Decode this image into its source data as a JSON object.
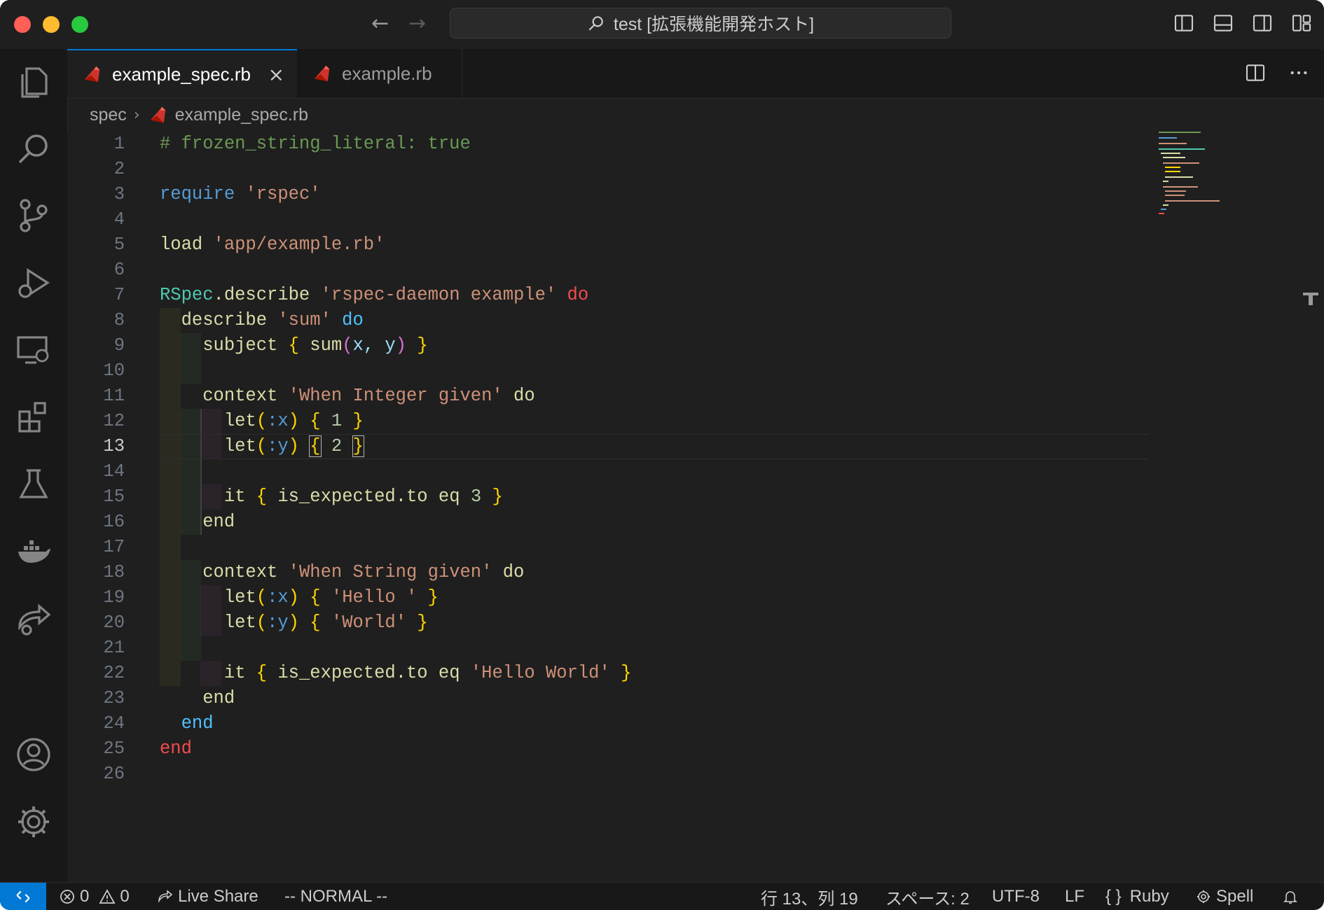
{
  "titlebar": {
    "search_text": "test [拡張機能開発ホスト]",
    "back_icon": "←",
    "forward_icon": "→"
  },
  "tabs": [
    {
      "label": "example_spec.rb",
      "active": true,
      "close": "×"
    },
    {
      "label": "example.rb",
      "active": false
    }
  ],
  "breadcrumb": {
    "folder": "spec",
    "sep": "›",
    "file": "example_spec.rb"
  },
  "editor": {
    "current_line": 13,
    "lines": [
      {
        "n": "1"
      },
      {
        "n": "2"
      },
      {
        "n": "3"
      },
      {
        "n": "4"
      },
      {
        "n": "5"
      },
      {
        "n": "6"
      },
      {
        "n": "7"
      },
      {
        "n": "8"
      },
      {
        "n": "9"
      },
      {
        "n": "10"
      },
      {
        "n": "11"
      },
      {
        "n": "12"
      },
      {
        "n": "13"
      },
      {
        "n": "14"
      },
      {
        "n": "15"
      },
      {
        "n": "16"
      },
      {
        "n": "17"
      },
      {
        "n": "18"
      },
      {
        "n": "19"
      },
      {
        "n": "20"
      },
      {
        "n": "21"
      },
      {
        "n": "22"
      },
      {
        "n": "23"
      },
      {
        "n": "24"
      },
      {
        "n": "25"
      },
      {
        "n": "26"
      }
    ],
    "code": {
      "l1": "# frozen_string_literal: true",
      "l3_kw": "require",
      "l3_str": "'rspec'",
      "l5_fn": "load",
      "l5_str": "'app/example.rb'",
      "l7_cls": "RSpec",
      "l7_fn": ".describe",
      "l7_str": "'rspec-daemon example'",
      "l7_do": "do",
      "l8_fn": "describe",
      "l8_str": "'sum'",
      "l8_do": "do",
      "l9_fn": "subject",
      "l9_ob": "{",
      "l9_call": "sum",
      "l9_op": "(",
      "l9_args": "x, y",
      "l9_cp": ")",
      "l9_cb": "}",
      "l11_fn": "context",
      "l11_str": "'When Integer given'",
      "l11_do": "do",
      "l12_fn": "let",
      "l12_op": "(",
      "l12_sym": ":x",
      "l12_cp": ")",
      "l12_ob": "{",
      "l12_val": "1",
      "l12_cb": "}",
      "l13_fn": "let",
      "l13_op": "(",
      "l13_sym": ":y",
      "l13_cp": ")",
      "l13_ob": "{",
      "l13_val": "2",
      "l13_cb": "}",
      "l15_fn": "it",
      "l15_ob": "{",
      "l15_body": "is_expected.to eq",
      "l15_val": "3",
      "l15_cb": "}",
      "l16_end": "end",
      "l18_fn": "context",
      "l18_str": "'When String given'",
      "l18_do": "do",
      "l19_fn": "let",
      "l19_op": "(",
      "l19_sym": ":x",
      "l19_cp": ")",
      "l19_ob": "{",
      "l19_str": "'Hello '",
      "l19_cb": "}",
      "l20_fn": "let",
      "l20_op": "(",
      "l20_sym": ":y",
      "l20_cp": ")",
      "l20_ob": "{",
      "l20_str": "'World'",
      "l20_cb": "}",
      "l22_fn": "it",
      "l22_ob": "{",
      "l22_body": "is_expected.to eq",
      "l22_str": "'Hello World'",
      "l22_cb": "}",
      "l23_end": "end",
      "l24_end": "end",
      "l25_end": "end"
    }
  },
  "statusbar": {
    "errors": "0",
    "warnings": "0",
    "live_share": "Live Share",
    "vim_mode": "-- NORMAL --",
    "position": "行 13、列 19",
    "spaces": "スペース: 2",
    "encoding": "UTF-8",
    "eol": "LF",
    "language_braces": "{ }",
    "language": "Ruby",
    "spell": "Spell"
  },
  "colors": {
    "accent": "#0078d4",
    "background": "#1f1f1f",
    "sidebar": "#181818"
  },
  "icons": {
    "activity": [
      "explorer-icon",
      "search-icon",
      "source-control-icon",
      "run-debug-icon",
      "remote-explorer-icon",
      "extensions-icon",
      "testing-icon",
      "docker-icon",
      "live-share-icon",
      "account-icon",
      "settings-gear-icon"
    ]
  }
}
